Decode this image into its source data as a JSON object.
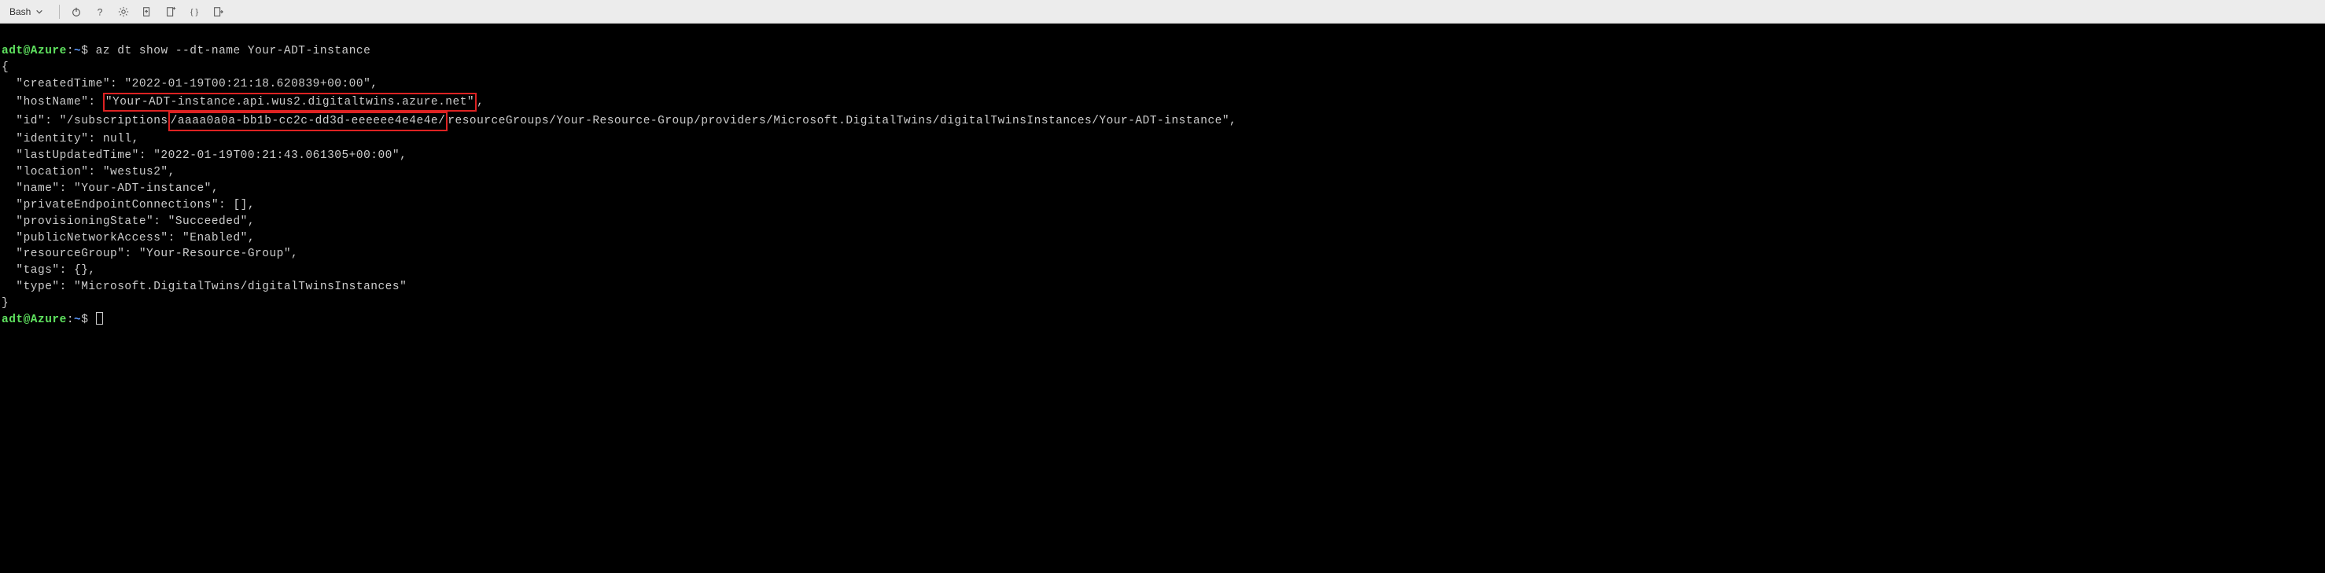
{
  "toolbar": {
    "shell": "Bash"
  },
  "terminal": {
    "prompt_user": "adt@Azure",
    "prompt_sep": ":",
    "prompt_path": "~",
    "prompt_dollar": "$",
    "command": "az dt show --dt-name Your-ADT-instance",
    "json_open": "{",
    "lines": {
      "createdTime_key": "  \"createdTime\": ",
      "createdTime_val": "\"2022-01-19T00:21:18.620839+00:00\",",
      "hostName_key": "  \"hostName\": ",
      "hostName_val": "\"Your-ADT-instance.api.wus2.digitaltwins.azure.net\"",
      "hostName_tail": ",",
      "id_key": "  \"id\": \"/subscriptions",
      "id_hl": "/aaaa0a0a-bb1b-cc2c-dd3d-eeeeee4e4e4e/",
      "id_tail": "resourceGroups/Your-Resource-Group/providers/Microsoft.DigitalTwins/digitalTwinsInstances/Your-ADT-instance\",",
      "identity": "  \"identity\": null,",
      "lastUpdatedTime": "  \"lastUpdatedTime\": \"2022-01-19T00:21:43.061305+00:00\",",
      "location": "  \"location\": \"westus2\",",
      "name": "  \"name\": \"Your-ADT-instance\",",
      "privateEndpointConnections": "  \"privateEndpointConnections\": [],",
      "provisioningState": "  \"provisioningState\": \"Succeeded\",",
      "publicNetworkAccess": "  \"publicNetworkAccess\": \"Enabled\",",
      "resourceGroup": "  \"resourceGroup\": \"Your-Resource-Group\",",
      "tags": "  \"tags\": {},",
      "type": "  \"type\": \"Microsoft.DigitalTwins/digitalTwinsInstances\""
    },
    "json_close": "}"
  }
}
